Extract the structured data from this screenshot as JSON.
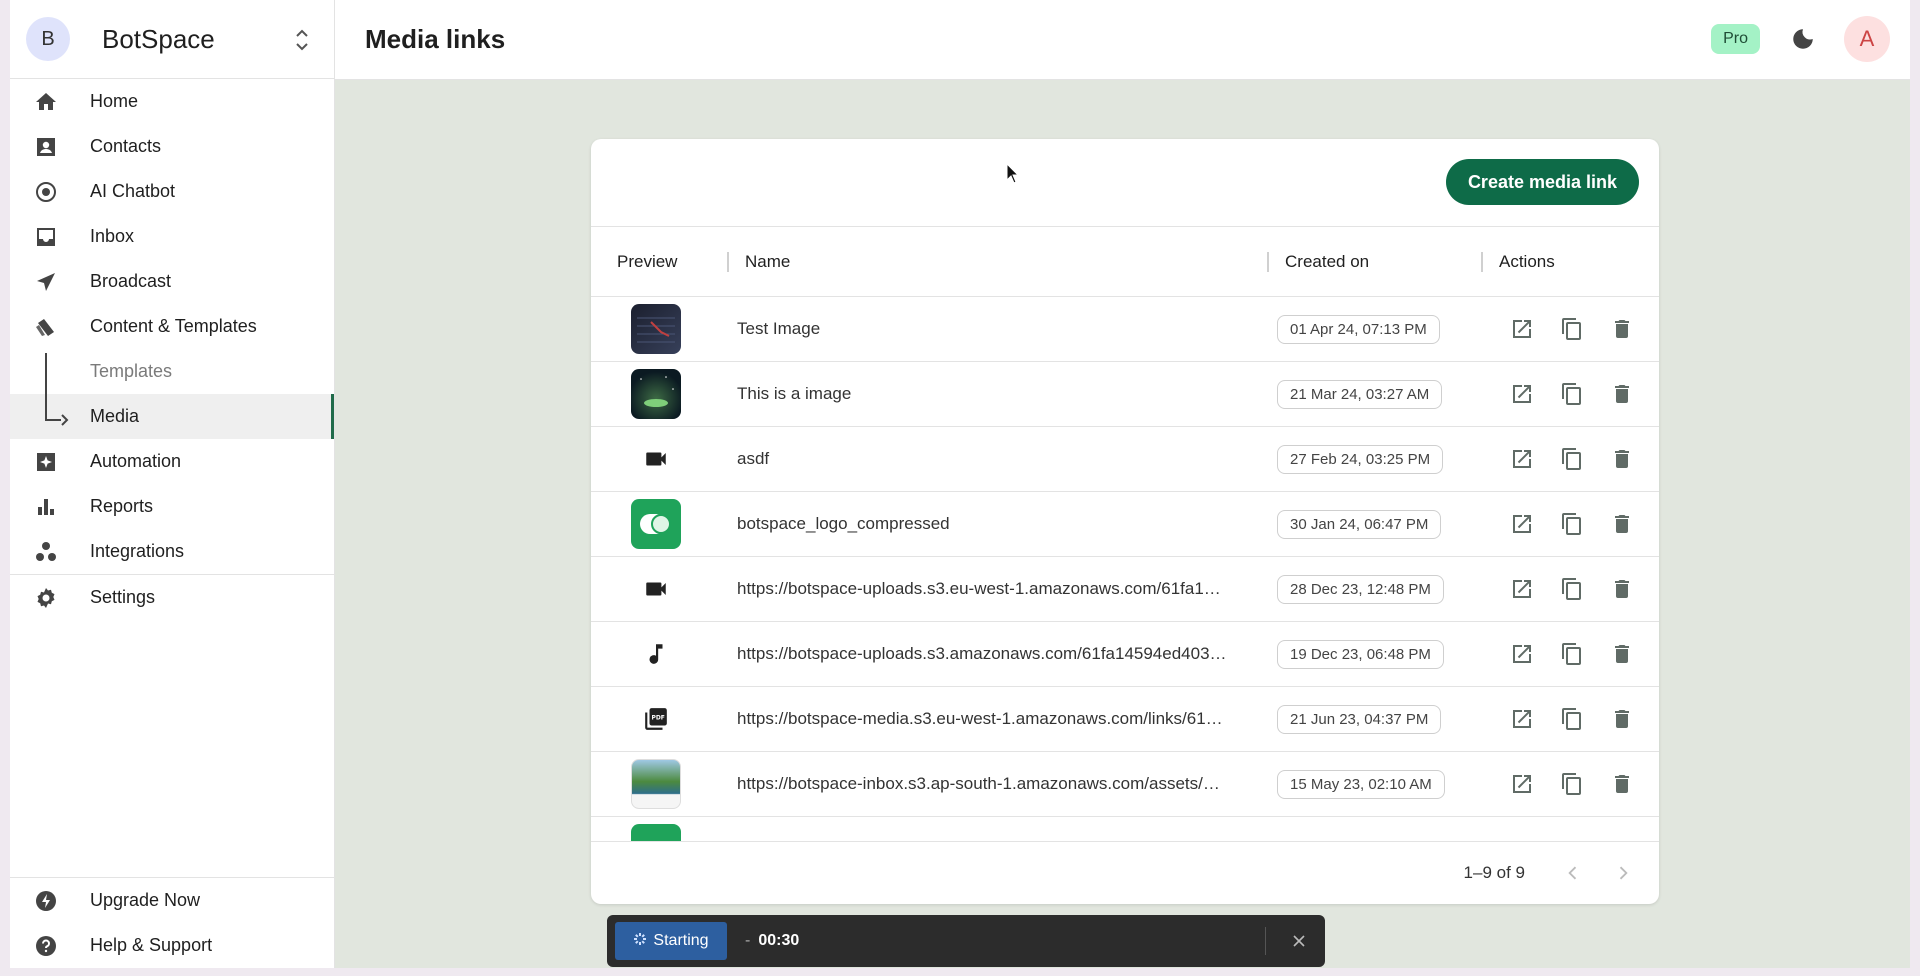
{
  "brand": {
    "initial": "B",
    "name": "BotSpace"
  },
  "sidebar": {
    "items": [
      {
        "label": "Home",
        "icon": "home-icon"
      },
      {
        "label": "Contacts",
        "icon": "contacts-icon"
      },
      {
        "label": "AI Chatbot",
        "icon": "chatbot-icon"
      },
      {
        "label": "Inbox",
        "icon": "inbox-icon"
      },
      {
        "label": "Broadcast",
        "icon": "broadcast-icon"
      },
      {
        "label": "Content & Templates",
        "icon": "content-icon"
      },
      {
        "label": "Templates",
        "icon": ""
      },
      {
        "label": "Media",
        "icon": ""
      },
      {
        "label": "Automation",
        "icon": "automation-icon"
      },
      {
        "label": "Reports",
        "icon": "reports-icon"
      },
      {
        "label": "Integrations",
        "icon": "integrations-icon"
      }
    ],
    "settings": {
      "label": "Settings",
      "icon": "gear-icon"
    },
    "bottom": [
      {
        "label": "Upgrade Now",
        "icon": "lightning-icon"
      },
      {
        "label": "Help & Support",
        "icon": "help-icon"
      }
    ]
  },
  "header": {
    "title": "Media links",
    "badge": "Pro",
    "user_initial": "A"
  },
  "media": {
    "create_label": "Create media link",
    "columns": {
      "preview": "Preview",
      "name": "Name",
      "created": "Created on",
      "actions": "Actions"
    },
    "rows": [
      {
        "name": "Test Image",
        "created": "01 Apr 24, 07:13 PM",
        "preview": "image"
      },
      {
        "name": "This is a image",
        "created": "21 Mar 24, 03:27 AM",
        "preview": "image"
      },
      {
        "name": "asdf",
        "created": "27 Feb 24, 03:25 PM",
        "preview": "video-icon"
      },
      {
        "name": "botspace_logo_compressed",
        "created": "30 Jan 24, 06:47 PM",
        "preview": "image"
      },
      {
        "name": "https://botspace-uploads.s3.eu-west-1.amazonaws.com/61fa1…",
        "created": "28 Dec 23, 12:48 PM",
        "preview": "video-icon"
      },
      {
        "name": "https://botspace-uploads.s3.amazonaws.com/61fa14594ed403…",
        "created": "19 Dec 23, 06:48 PM",
        "preview": "music-note-icon"
      },
      {
        "name": "https://botspace-media.s3.eu-west-1.amazonaws.com/links/61…",
        "created": "21 Jun 23, 04:37 PM",
        "preview": "pdf-icon"
      },
      {
        "name": "https://botspace-inbox.s3.ap-south-1.amazonaws.com/assets/…",
        "created": "15 May 23, 02:10 AM",
        "preview": "image"
      }
    ],
    "pagination": "1–9 of 9"
  },
  "recorder": {
    "start_label": "Starting",
    "dash": "-",
    "time": "00:30"
  },
  "colors": {
    "accent": "#0e6b48",
    "main_bg": "#e1e6de",
    "pro_badge": "#a4f2c6"
  }
}
